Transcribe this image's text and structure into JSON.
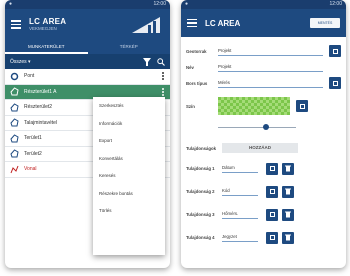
{
  "left_screen": {
    "status_time": "12:00",
    "app_title": "LC AREA",
    "app_subtitle": "VEKMEGJEN",
    "tabs": [
      {
        "label": "MUNKATERÜLET",
        "active": true
      },
      {
        "label": "TÉRKÉP",
        "active": false
      }
    ],
    "filter_select": "Összes",
    "items": [
      {
        "label": "Pont",
        "icon": "point-icon",
        "selected": false
      },
      {
        "label": "Részterület1 A",
        "icon": "area-icon",
        "selected": true
      },
      {
        "label": "Részterület2",
        "icon": "area-icon",
        "selected": false
      },
      {
        "label": "Talajmintavétel",
        "icon": "area-icon",
        "selected": false
      },
      {
        "label": "Terület1",
        "icon": "area-icon",
        "selected": false
      },
      {
        "label": "Terület2",
        "icon": "area-icon",
        "selected": false
      },
      {
        "label": "Vonal",
        "icon": "line-icon",
        "selected": false
      }
    ],
    "context_menu": [
      "Szerkesztés",
      "Információk",
      "Export",
      "Konvertálás",
      "Keresés",
      "Részekre bontás",
      "Törlés"
    ]
  },
  "right_screen": {
    "status_time": "12:00",
    "app_title": "LC AREA",
    "top_button": "MENTÉS",
    "fields": [
      {
        "label": "Geotorrak",
        "value": "Projekt"
      },
      {
        "label": "Név",
        "value": "Projekt"
      },
      {
        "label": "Bors típus",
        "value": "Mérés"
      }
    ],
    "color_label": "Szín",
    "color_hex": "#7cc64a",
    "slider_value": 0.62,
    "attributes_label": "Tulajdonságok",
    "add_button": "HOZZÁAD",
    "attributes": [
      {
        "label": "Tulajdonság 1",
        "value": "Dátum"
      },
      {
        "label": "Tulajdonság 2",
        "value": "Kód"
      },
      {
        "label": "Tulajdonság 3",
        "value": "Hőmérs."
      },
      {
        "label": "Tulajdonság 4",
        "value": "Jegyzet"
      }
    ]
  }
}
